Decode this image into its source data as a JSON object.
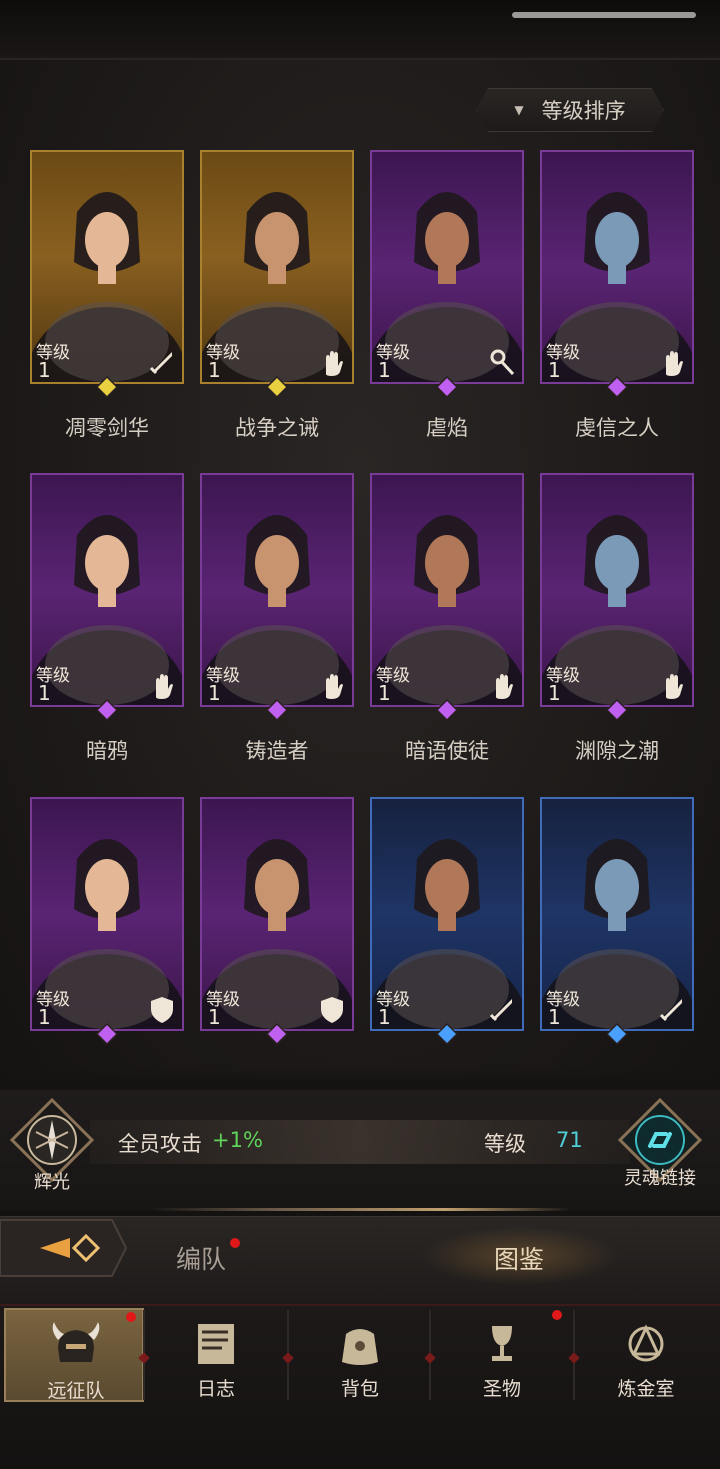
{
  "header": {
    "sort_label": "等级排序"
  },
  "level_label": "等级",
  "heroes": [
    {
      "name": "凋零剑华",
      "level": "1",
      "rarity": "gold",
      "class_icon": "sword-icon"
    },
    {
      "name": "战争之诫",
      "level": "1",
      "rarity": "gold",
      "class_icon": "hand-icon"
    },
    {
      "name": "虐焰",
      "level": "1",
      "rarity": "purple",
      "class_icon": "staff-icon"
    },
    {
      "name": "虔信之人",
      "level": "1",
      "rarity": "purple",
      "class_icon": "hand-icon"
    },
    {
      "name": "暗鸦",
      "level": "1",
      "rarity": "purple",
      "class_icon": "hand-icon"
    },
    {
      "name": "铸造者",
      "level": "1",
      "rarity": "purple",
      "class_icon": "hand-icon"
    },
    {
      "name": "暗语使徒",
      "level": "1",
      "rarity": "purple",
      "class_icon": "hand-icon"
    },
    {
      "name": "渊隙之潮",
      "level": "1",
      "rarity": "purple",
      "class_icon": "hand-icon"
    },
    {
      "name": "",
      "level": "1",
      "rarity": "purple",
      "class_icon": "shield-icon"
    },
    {
      "name": "",
      "level": "1",
      "rarity": "purple",
      "class_icon": "shield-icon"
    },
    {
      "name": "",
      "level": "1",
      "rarity": "blue",
      "class_icon": "sword-icon"
    },
    {
      "name": "",
      "level": "1",
      "rarity": "blue",
      "class_icon": "sword-icon"
    }
  ],
  "stats": {
    "radiance_label": "辉光",
    "attack_label": "全员攻击",
    "attack_value": "+1%",
    "level_label": "等级",
    "level_value": "71",
    "soul_link_label": "灵魂链接"
  },
  "tabs": {
    "formation": "编队",
    "codex": "图鉴"
  },
  "nav": [
    {
      "label": "远征队",
      "icon": "helmet-icon",
      "active": true
    },
    {
      "label": "日志",
      "icon": "scroll-icon",
      "active": false
    },
    {
      "label": "背包",
      "icon": "bag-icon",
      "active": false
    },
    {
      "label": "圣物",
      "icon": "grail-icon",
      "active": false
    },
    {
      "label": "炼金室",
      "icon": "alchemy-icon",
      "active": false
    }
  ],
  "colors": {
    "gold": "#a8802e",
    "purple": "#7a3a98",
    "blue": "#3f6bb8",
    "positive": "#5fd35a",
    "level_value": "#4fd0d8",
    "notify": "#e01818"
  }
}
